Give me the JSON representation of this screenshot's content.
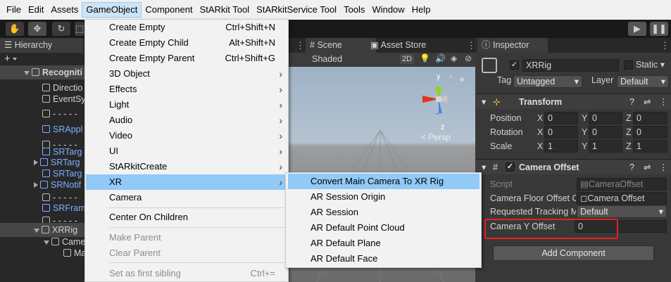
{
  "menubar": {
    "items": [
      "File",
      "Edit",
      "Assets",
      "GameObject",
      "Component",
      "StARkit Tool",
      "StARkitService Tool",
      "Tools",
      "Window",
      "Help"
    ]
  },
  "hierarchy": {
    "tab_label": "Hierarchy",
    "add_label": "+",
    "rows": [
      {
        "label": "Recogniti",
        "style": "scene"
      },
      {
        "label": "Directio",
        "style": "normal"
      },
      {
        "label": "EventSy",
        "style": "normal"
      },
      {
        "label": "- - - - -",
        "style": "normal"
      },
      {
        "label": "SRAppl",
        "style": "blue"
      },
      {
        "label": "- - - - -",
        "style": "normal"
      },
      {
        "label": "SRTarg",
        "style": "blue"
      },
      {
        "label": "SRTarg",
        "style": "blue"
      },
      {
        "label": "SRTarg",
        "style": "blue"
      },
      {
        "label": "SRNotif",
        "style": "blue"
      },
      {
        "label": "- - - - -",
        "style": "normal"
      },
      {
        "label": "SRFram",
        "style": "blue"
      },
      {
        "label": "- - - - -",
        "style": "normal"
      },
      {
        "label": "XRRig",
        "style": "sel"
      },
      {
        "label": "Came",
        "style": "normal"
      },
      {
        "label": "Ma",
        "style": "normal"
      }
    ]
  },
  "gameobject_menu": {
    "items": [
      {
        "label": "Create Empty",
        "shortcut": "Ctrl+Shift+N"
      },
      {
        "label": "Create Empty Child",
        "shortcut": "Alt+Shift+N"
      },
      {
        "label": "Create Empty Parent",
        "shortcut": "Ctrl+Shift+G"
      },
      {
        "label": "3D Object",
        "submenu": true
      },
      {
        "label": "Effects",
        "submenu": true
      },
      {
        "label": "Light",
        "submenu": true
      },
      {
        "label": "Audio",
        "submenu": true
      },
      {
        "label": "Video",
        "submenu": true
      },
      {
        "label": "UI",
        "submenu": true
      },
      {
        "label": "StARkitCreate",
        "submenu": true
      },
      {
        "label": "XR",
        "submenu": true,
        "highlighted": true
      },
      {
        "label": "Camera"
      },
      {
        "label": "Center On Children"
      },
      {
        "label": "Make Parent",
        "disabled": true
      },
      {
        "label": "Clear Parent",
        "disabled": true
      },
      {
        "label": "Set as first sibling",
        "shortcut": "Ctrl+=",
        "disabled": true
      }
    ]
  },
  "xr_submenu": {
    "items": [
      {
        "label": "Convert Main Camera To XR Rig",
        "highlighted": true
      },
      {
        "label": "AR Session Origin"
      },
      {
        "label": "AR Session"
      },
      {
        "label": "AR Default Point Cloud"
      },
      {
        "label": "AR Default Plane"
      },
      {
        "label": "AR Default Face"
      }
    ]
  },
  "scene": {
    "tab_scene": "Scene",
    "tab_asset_store": "Asset Store",
    "shading_mode": "Shaded",
    "mode_2d": "2D",
    "gizmo_y": "y",
    "gizmo_z": "z",
    "persp_label": "Persp"
  },
  "inspector": {
    "tab_label": "Inspector",
    "object_name": "XRRig",
    "static_label": "Static",
    "tag_label": "Tag",
    "tag_value": "Untagged",
    "layer_label": "Layer",
    "layer_value": "Default",
    "transform": {
      "title": "Transform",
      "position": {
        "label": "Position",
        "x": "0",
        "y": "0",
        "z": "0"
      },
      "rotation": {
        "label": "Rotation",
        "x": "0",
        "y": "0",
        "z": "0"
      },
      "scale": {
        "label": "Scale",
        "x": "1",
        "y": "1",
        "z": "1"
      },
      "axis_x": "X",
      "axis_y": "Y",
      "axis_z": "Z"
    },
    "camera_offset": {
      "title": "Camera Offset",
      "script_label": "Script",
      "script_value": "CameraOffset",
      "floor_label": "Camera Floor Offset C",
      "floor_value": "Camera Offset",
      "tracking_label": "Requested Tracking M",
      "tracking_value": "Default",
      "y_offset_label": "Camera Y Offset",
      "y_offset_value": "0"
    },
    "add_component_label": "Add Component"
  },
  "colors": {
    "menu_highlight": "#91c9f7",
    "annotation_red": "#e8201c",
    "prefab_blue": "#7cb0ff"
  }
}
